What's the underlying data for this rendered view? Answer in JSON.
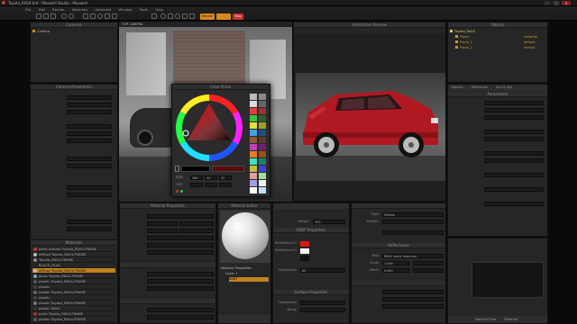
{
  "window": {
    "title": "Toyota_RAV4.hrd - Maxwell Studio - Maxwell",
    "controls": [
      "–",
      "□",
      "×"
    ]
  },
  "menu": {
    "items": [
      "File",
      "Edit",
      "Render",
      "Materials",
      "Generate",
      "Window",
      "Tools",
      "Help"
    ],
    "right_dropdown": "Maxwell Render"
  },
  "toolbar": {
    "render_label": "Render",
    "stop_label": "Stop"
  },
  "panels": {
    "left_top": "Cameras",
    "camera_item": "Camera",
    "left_mid": "Camera Parameters",
    "left_materials": "Materials",
    "viewport": "Viewport",
    "viewport_label": "TOP CAMERA",
    "color_picker": "Color Picker",
    "preview": "Interactive Preview",
    "objects": "Objects",
    "objects_tabs": [
      "Objects",
      "Options"
    ],
    "material_editor": "Material Editor",
    "layers_header": "Layers / BSDF",
    "bsdf": "BSDF Properties",
    "reflectance": "Reflectance",
    "surface_props": "Surface Properties",
    "right_props": "Parameters",
    "right_tabs": [
      "Objects",
      "Reference",
      "Sun & Sky"
    ],
    "bottom_left": "Material Properties",
    "bottom_right_tabs": [
      "Material Tree",
      "Material"
    ]
  },
  "scene_tree": [
    {
      "name": "Toyota_RAV4",
      "color": "#d6c96a",
      "mat": ""
    },
    {
      "name": "Plane",
      "color": "#c89a30",
      "mat": "material"
    },
    {
      "name": "Plane_1",
      "color": "#c89a30",
      "mat": "default"
    },
    {
      "name": "Plane_2",
      "color": "#c89a30",
      "mat": "default"
    }
  ],
  "materials": [
    {
      "name": "paint tomato Toyota_RAV4-FRAME",
      "color": "#c0392b",
      "selected": false
    },
    {
      "name": "diffuse Toyota_RAV4-FRAME",
      "color": "#bbbbbb",
      "selected": false
    },
    {
      "name": "Toyota_RAV4-FRAME",
      "color": "#888888",
      "selected": false
    },
    {
      "name": "BLACK_PLAS",
      "color": "#222222",
      "selected": false
    },
    {
      "name": "diffuse Toyota_RAV4-FRAME",
      "color": "#bbbbbb",
      "selected": true
    },
    {
      "name": "glass Toyota_RAV4-FRAME",
      "color": "#7aa0c0",
      "selected": false
    },
    {
      "name": "plastic Toyota_RAV4-FRAME",
      "color": "#555555",
      "selected": false
    },
    {
      "name": "plastic",
      "color": "#444444",
      "selected": false
    },
    {
      "name": "plastic Toyota_RAV4-FRAME",
      "color": "#666666",
      "selected": false
    },
    {
      "name": "plastic",
      "color": "#444444",
      "selected": false
    },
    {
      "name": "plastic Toyota_RAV4-FRAME",
      "color": "#777777",
      "selected": false
    },
    {
      "name": "plastic RAV4",
      "color": "#333333",
      "selected": false
    },
    {
      "name": "paint Toyota_RAV4-FRAME",
      "color": "#aa3322",
      "selected": false
    },
    {
      "name": "plastic Toyota_RAV4-FRAME",
      "color": "#555555",
      "selected": false
    }
  ],
  "layer_tree": {
    "material_label": "Material Properties",
    "layer": "Layer 1",
    "bsdf": "BSDF"
  },
  "bsdf_props": {
    "weight_label": "Weight",
    "weight_value": "100",
    "reflectance0_label": "Reflectance 0°",
    "reflectance90_label": "Reflectance 90°",
    "roughness_label": "Roughness",
    "roughness_value": "60",
    "surface_label": "Surface Properties",
    "roughness_row": "Roughness",
    "bump_label": "Bump"
  },
  "color_picker": {
    "rgb_label": "RGB",
    "hsv_label": "HSV",
    "r": "180",
    "g": "12",
    "b": "12"
  },
  "right_properties": {
    "type_label": "Type",
    "type_value": "Diffuse",
    "emitter_label": "Emitter",
    "section": "Reflectance",
    "map_label": "Map",
    "map_value": "RAV4_paint_map.png",
    "scale_label": "Scale",
    "scale_value": "1.000",
    "offset_label": "Offset",
    "offset_value": "0.000"
  },
  "colors": {
    "car_red": "#b01822",
    "accent_orange": "#d88a20",
    "stop_red": "#c8302a",
    "selection": "#c0821e",
    "swatch_blue": "#2233dd"
  }
}
